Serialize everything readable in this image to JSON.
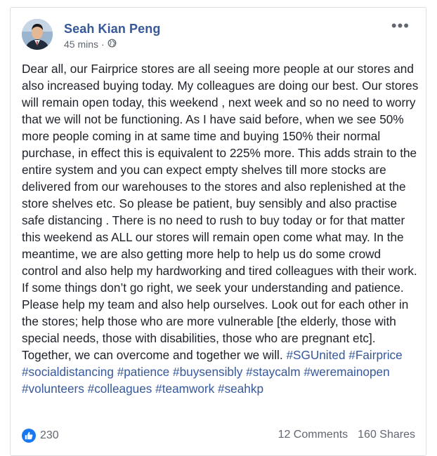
{
  "post": {
    "author": "Seah Kian Peng",
    "time": "45 mins",
    "separator": "·",
    "privacy_icon": "globe-icon",
    "more_label": "•••",
    "body": "Dear all, our Fairprice stores are all seeing more people at our stores and also increased buying today. My colleagues are doing our best. Our stores will remain open today, this weekend , next week and so no need to worry that we will not be functioning. As I have said before, when we see 50% more people coming in at same time and buying 150% their normal purchase, in effect this is equivalent to 225% more. This adds strain to the entire system and you can expect empty shelves till more stocks are delivered from our warehouses to the stores and also replenished at the store shelves etc. So please be patient, buy sensibly and also practise safe distancing . There is no need to rush to buy today or for that matter this weekend as ALL our stores will remain open come what may. In the meantime, we are also getting more help to help us do some crowd control and also help my hardworking and tired colleagues with their work. If some things don’t go right, we seek your understanding and patience. Please help my team and also help ourselves. Look out for each other in the stores; help those who are more vulnerable [the elderly, those with special needs, those with disabilities, those who are pregnant etc]. Together, we can overcome and together we will.",
    "hashtags": [
      "#SGUnited",
      "#Fairprice",
      "#socialdistancing",
      "#patience",
      "#buysensibly",
      "#staycalm",
      "#weremainopen",
      "#volunteers",
      "#colleagues",
      "#teamwork",
      "#seahkp"
    ]
  },
  "footer": {
    "reaction_icon": "thumbs-up-icon",
    "likes": "230",
    "comments": "12 Comments",
    "shares": "160 Shares"
  },
  "colors": {
    "link": "#365899",
    "like_blue": "#1877f2",
    "text": "#1d2129",
    "meta": "#606770"
  }
}
